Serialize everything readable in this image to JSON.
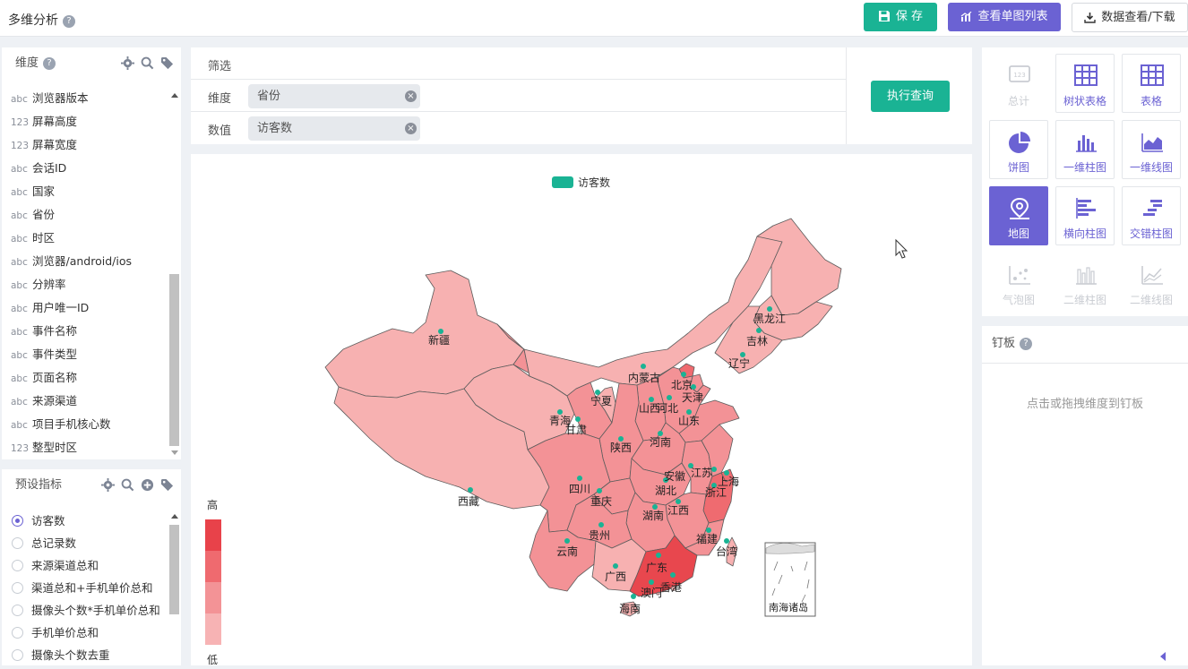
{
  "header": {
    "title": "多维分析",
    "help": "?",
    "save_label": "保 存",
    "list_label": "查看单图列表",
    "download_label": "数据查看/下载"
  },
  "dimensions": {
    "title": "维度",
    "fields": [
      {
        "type": "abc",
        "name": "浏览器版本"
      },
      {
        "type": "123",
        "name": "屏幕高度"
      },
      {
        "type": "123",
        "name": "屏幕宽度"
      },
      {
        "type": "abc",
        "name": "会话ID"
      },
      {
        "type": "abc",
        "name": "国家"
      },
      {
        "type": "abc",
        "name": "省份"
      },
      {
        "type": "abc",
        "name": "时区"
      },
      {
        "type": "abc",
        "name": "浏览器/android/ios"
      },
      {
        "type": "abc",
        "name": "分辨率"
      },
      {
        "type": "abc",
        "name": "用户唯一ID"
      },
      {
        "type": "abc",
        "name": "事件名称"
      },
      {
        "type": "abc",
        "name": "事件类型"
      },
      {
        "type": "abc",
        "name": "页面名称"
      },
      {
        "type": "abc",
        "name": "来源渠道"
      },
      {
        "type": "abc",
        "name": "项目手机核心数"
      },
      {
        "type": "123",
        "name": "整型时区"
      }
    ]
  },
  "indicators": {
    "title": "预设指标",
    "items": [
      {
        "name": "访客数",
        "selected": true
      },
      {
        "name": "总记录数",
        "selected": false
      },
      {
        "name": "来源渠道总和",
        "selected": false
      },
      {
        "name": "渠道总和+手机单价总和",
        "selected": false
      },
      {
        "name": "摄像头个数*手机单价总和",
        "selected": false
      },
      {
        "name": "手机单价总和",
        "selected": false
      },
      {
        "name": "摄像头个数去重",
        "selected": false
      }
    ]
  },
  "filter": {
    "filter_label": "筛选",
    "dimension_label": "维度",
    "dimension_value": "省份",
    "value_label": "数值",
    "value_value": "访客数",
    "run_label": "执行查询",
    "clear_glyph": "×"
  },
  "chart_data": {
    "type": "map",
    "legend": [
      "访客数"
    ],
    "visual_map": {
      "high_label": "高",
      "low_label": "低",
      "colors": [
        "#e8424a",
        "#ef6a6f",
        "#f39396",
        "#f7b3b4"
      ]
    },
    "regions": [
      {
        "name": "新疆",
        "level": 1
      },
      {
        "name": "西藏",
        "level": 1
      },
      {
        "name": "青海",
        "level": 1
      },
      {
        "name": "甘肃",
        "level": 2
      },
      {
        "name": "内蒙古",
        "level": 1
      },
      {
        "name": "黑龙江",
        "level": 1
      },
      {
        "name": "吉林",
        "level": 1
      },
      {
        "name": "辽宁",
        "level": 1
      },
      {
        "name": "宁夏",
        "level": 1
      },
      {
        "name": "北京",
        "level": 3
      },
      {
        "name": "天津",
        "level": 2
      },
      {
        "name": "河北",
        "level": 2
      },
      {
        "name": "山西",
        "level": 2
      },
      {
        "name": "山东",
        "level": 2
      },
      {
        "name": "河南",
        "level": 2
      },
      {
        "name": "陕西",
        "level": 2
      },
      {
        "name": "四川",
        "level": 2
      },
      {
        "name": "重庆",
        "level": 2
      },
      {
        "name": "湖北",
        "level": 2
      },
      {
        "name": "安徽",
        "level": 2
      },
      {
        "name": "江苏",
        "level": 2
      },
      {
        "name": "上海",
        "level": 3
      },
      {
        "name": "浙江",
        "level": 3
      },
      {
        "name": "江西",
        "level": 2
      },
      {
        "name": "湖南",
        "level": 2
      },
      {
        "name": "贵州",
        "level": 2
      },
      {
        "name": "云南",
        "level": 2
      },
      {
        "name": "广西",
        "level": 1
      },
      {
        "name": "广东",
        "level": 4
      },
      {
        "name": "福建",
        "level": 2
      },
      {
        "name": "台湾",
        "level": 1
      },
      {
        "name": "海南",
        "level": 1
      },
      {
        "name": "香港",
        "level": 1
      },
      {
        "name": "澳门",
        "level": 1
      }
    ],
    "inset_label": "南海诸岛"
  },
  "chart_types": [
    {
      "name": "总计",
      "icon": "total-icon",
      "state": "disabled"
    },
    {
      "name": "树状表格",
      "icon": "tree-table-icon",
      "state": "normal"
    },
    {
      "name": "表格",
      "icon": "table-icon",
      "state": "normal"
    },
    {
      "name": "饼图",
      "icon": "pie-chart-icon",
      "state": "normal"
    },
    {
      "name": "一维柱图",
      "icon": "bar-chart-icon",
      "state": "normal"
    },
    {
      "name": "一维线图",
      "icon": "area-chart-icon",
      "state": "normal"
    },
    {
      "name": "地图",
      "icon": "map-pin-icon",
      "state": "active"
    },
    {
      "name": "横向柱图",
      "icon": "hbar-chart-icon",
      "state": "normal"
    },
    {
      "name": "交错柱图",
      "icon": "stagger-bar-icon",
      "state": "normal"
    },
    {
      "name": "气泡图",
      "icon": "bubble-chart-icon",
      "state": "disabled"
    },
    {
      "name": "二维柱图",
      "icon": "bar2d-chart-icon",
      "state": "disabled"
    },
    {
      "name": "二维线图",
      "icon": "line2d-chart-icon",
      "state": "disabled"
    }
  ],
  "pinboard": {
    "title": "钉板",
    "hint": "点击或拖拽维度到钉板"
  },
  "colors": {
    "accent": "#1ab394",
    "brand": "#6b62d3"
  }
}
